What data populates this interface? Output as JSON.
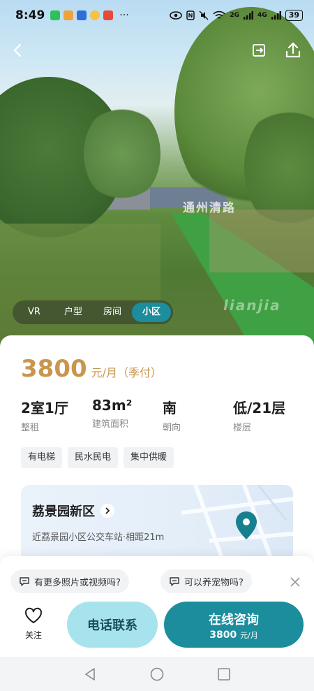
{
  "status_bar": {
    "time": "8:49",
    "network_labels": [
      "2G",
      "4G"
    ],
    "battery": "39"
  },
  "hero": {
    "watermark_brand": "lianjia",
    "watermark_place": "通州清路"
  },
  "media_tabs": [
    {
      "label": "VR",
      "active": false
    },
    {
      "label": "户型",
      "active": false
    },
    {
      "label": "房间",
      "active": false
    },
    {
      "label": "小区",
      "active": true
    }
  ],
  "listing": {
    "price": "3800",
    "price_unit": "元/月（季付）",
    "specs": [
      {
        "value": "2室1厅",
        "label": "整租"
      },
      {
        "value": "83m²",
        "label": "建筑面积"
      },
      {
        "value": "南",
        "label": "朝向"
      },
      {
        "value": "低/21层",
        "label": "楼层"
      }
    ],
    "tags": [
      "有电梯",
      "民水民电",
      "集中供暖"
    ]
  },
  "community": {
    "name": "荔景园新区",
    "address": "近荔景园小区公交车站·相距21m"
  },
  "quick_questions": [
    "有更多照片或视频吗?",
    "可以养宠物吗?"
  ],
  "actions": {
    "follow_label": "关注",
    "phone_label": "电话联系",
    "consult_label": "在线咨询",
    "consult_price": "3800",
    "consult_price_unit": "元/月"
  },
  "colors": {
    "accent": "#1b8d9c",
    "price": "#c9964f",
    "phone_btn": "#a7e3ec"
  }
}
